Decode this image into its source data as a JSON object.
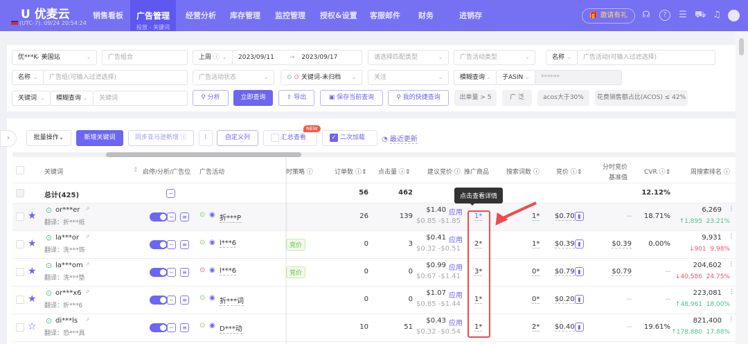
{
  "header": {
    "logo": "优麦云",
    "timezone": "(UTC-7): 09/24 20:54:24",
    "nav": [
      "销售看板",
      "广告管理",
      "经营分析",
      "库存管理",
      "监控管理",
      "授权&设置",
      "客服邮件",
      "财务",
      "进销存"
    ],
    "active_sub": "投放 - 关键词",
    "invite": "邀请有礼"
  },
  "filters": {
    "shop": "优***K- 美国站",
    "portfolio_ph": "广告组合",
    "period": "上周",
    "date_start": "2023/09/11",
    "date_end": "2023/09/17",
    "match_ph": "请选择匹配类型",
    "campaign_type_ph": "广告活动类型",
    "name_label": "名称",
    "campaign_ph": "广告活动(可输入过滤选择)",
    "name2_label": "名称",
    "adgroup_ph": "广告组(可输入过滤选择)",
    "campaign_status_ph": "广告活动状态",
    "keyword_status": "关键词-未归档",
    "follow_ph": "关注",
    "fuzzy": "模糊查询",
    "child_asin": "子ASIN",
    "asin_value": "******",
    "kw_label": "关键词",
    "fuzzy2": "模糊查询",
    "kw_ph": "关键词",
    "analyze": "分析",
    "query": "立即查询",
    "export": "导出",
    "save": "保存当前查询",
    "shortcut": "我的快捷查询",
    "chips": [
      "出单量 > 5",
      "广 泛",
      "acos大于30%",
      "花费销售额占比(ACOS) ≤ 42%"
    ]
  },
  "toolbar": {
    "bulk": "批量操作",
    "add": "新增关键词",
    "sync": "同步亚马逊新增",
    "custom": "自定义列",
    "summary": "汇总查看",
    "new_badge": "NEW",
    "reload": "二次加载",
    "recent": "最近更新"
  },
  "table": {
    "headers": {
      "keyword": "关键词",
      "toggle": "启停/分析/广告位",
      "campaign": "广告活动",
      "strategy": "时策略",
      "orders": "订单数",
      "clicks": "点击量",
      "suggest": "建议竞价",
      "product": "推广商品",
      "search_terms": "搜索词数",
      "bid": "竞价",
      "timed_bid_1": "分时竞价",
      "timed_bid_2": "基准值",
      "cvr": "CVR",
      "rank": "周搜索排名"
    },
    "total": {
      "label": "总计(425)",
      "orders": "56",
      "clicks": "462",
      "cvr": "12.12%"
    },
    "tooltip": "点击查看详情",
    "apply": "应用",
    "rows": [
      {
        "kw": "or***er",
        "tr": "翻译：折***纸",
        "starred": true,
        "camp": "折***P",
        "camp_status": "ok",
        "tag": "",
        "orders": "26",
        "clicks": "139",
        "sug": "$1.40",
        "range": "$0.85 -$1.85",
        "prod": "1*",
        "st": "1*",
        "bid": "$0.70",
        "timed": "--",
        "cvr": "18.71%",
        "rank": "6,269",
        "delta": "1,895",
        "pct": "23.21%",
        "dir": "up"
      },
      {
        "kw": "la***or",
        "tr": "翻译：洗***饰",
        "starred": true,
        "camp": "l***6",
        "camp_status": "ok",
        "tag": "竞价",
        "orders": "0",
        "clicks": "3",
        "sug": "$0.41",
        "range": "$0.32 -$0.51",
        "prod": "2*",
        "st": "1*",
        "bid": "$0.39",
        "timed": "$0.39",
        "cvr": "0.00%",
        "rank": "9,931",
        "delta": "901",
        "pct": "9.98%",
        "dir": "down"
      },
      {
        "kw": "la***om",
        "tr": "翻译：洗***垫",
        "starred": true,
        "camp": "l***6",
        "camp_status": "paused",
        "tag": "竞价",
        "orders": "0",
        "clicks": "0",
        "sug": "$0.99",
        "range": "$0.67 -$1.41",
        "prod": "3*",
        "st": "0*",
        "bid": "$0.79",
        "timed": "$0.79",
        "cvr": "--",
        "rank": "204,602",
        "delta": "40,586",
        "pct": "24.75%",
        "dir": "down"
      },
      {
        "kw": "or***x6",
        "tr": "翻译：折***6",
        "starred": true,
        "camp": "折***词",
        "camp_status": "ok",
        "tag": "",
        "orders": "0",
        "clicks": "0",
        "sug": "$1.07",
        "range": "$0.85 -$1.44",
        "prod": "1*",
        "st": "0*",
        "bid": "$0.20",
        "timed": "--",
        "cvr": "--",
        "rank": "223,081",
        "delta": "48,961",
        "pct": "18.00%",
        "dir": "up"
      },
      {
        "kw": "di***ls",
        "tr": "翻译：恐***具",
        "starred": false,
        "camp": "D***动",
        "camp_status": "ok",
        "tag": "",
        "orders": "10",
        "clicks": "51",
        "sug": "$0.43",
        "range": "$0.32 -$0.54",
        "prod": "1*",
        "st": "2*",
        "bid": "$0.40",
        "timed": "--",
        "cvr": "19.61%",
        "rank": "821,400",
        "delta": "178,880",
        "pct": "17.88%",
        "dir": "up"
      }
    ]
  },
  "colors": {
    "brand": "#7670f3",
    "accent": "#6c66f2",
    "up": "#4bc28a",
    "down": "#f0566b",
    "highlight": "#f04a4a"
  }
}
